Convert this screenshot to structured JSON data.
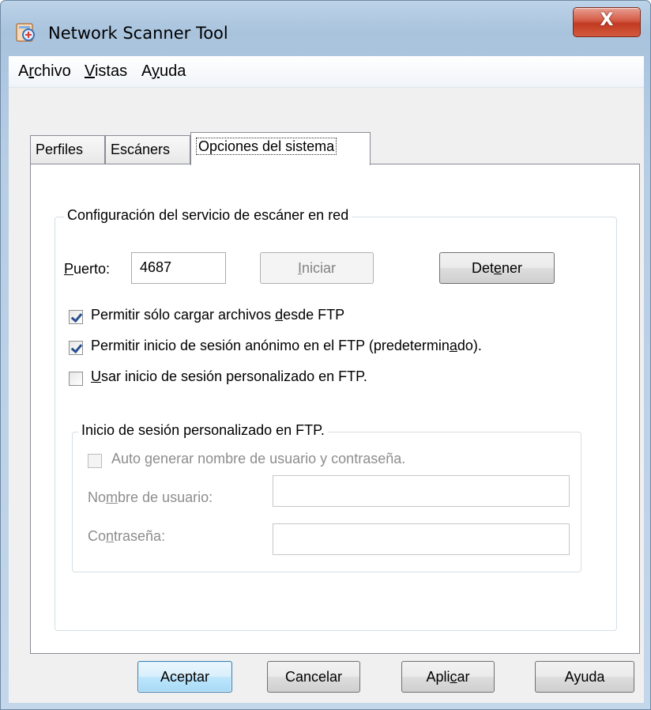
{
  "window": {
    "title": "Network Scanner Tool",
    "close_glyph": "X",
    "icon": "scanner-app-icon"
  },
  "menu": {
    "items": [
      {
        "label_pre": "A",
        "label_u": "r",
        "label_post": "chivo"
      },
      {
        "label_pre": "",
        "label_u": "V",
        "label_post": "istas"
      },
      {
        "label_pre": "A",
        "label_u": "y",
        "label_post": "uda"
      }
    ]
  },
  "tabs": [
    {
      "label": "Perfiles"
    },
    {
      "label": "Escáners"
    },
    {
      "label": "Opciones del sistema"
    }
  ],
  "service_group": {
    "title": "Configuración del servicio de escáner en red",
    "port_label_u": "P",
    "port_label_rest": "uerto:",
    "port_value": "4687",
    "start_button": {
      "pre": "",
      "u": "I",
      "post": "niciar"
    },
    "stop_button": {
      "pre": "Det",
      "u": "e",
      "post": "ner"
    },
    "options": [
      {
        "pre": "Permitir sólo cargar archivos ",
        "u": "d",
        "post": "esde FTP",
        "checked": true
      },
      {
        "pre": "Permitir inicio de sesión anónimo en el FTP (predetermin",
        "u": "a",
        "post": "do).",
        "checked": true
      },
      {
        "pre": "",
        "u": "U",
        "post": "sar inicio de sesión personalizado en FTP.",
        "checked": false
      }
    ]
  },
  "custom_login_group": {
    "title": "Inicio de sesión personalizado en FTP.",
    "auto_generate": {
      "pre": "Auto ",
      "u": "g",
      "post": "enerar nombre de usuario y contraseña.",
      "checked": false
    },
    "username_label": {
      "pre": "No",
      "u": "m",
      "post": "bre de usuario:"
    },
    "username_value": "",
    "password_label": {
      "pre": "Co",
      "u": "n",
      "post": "traseña:"
    },
    "password_value": ""
  },
  "footer_buttons": {
    "ok": {
      "pre": "Aceptar",
      "u": "",
      "post": ""
    },
    "cancel": {
      "pre": "Cancelar",
      "u": "",
      "post": ""
    },
    "apply": {
      "pre": "Apli",
      "u": "c",
      "post": "ar"
    },
    "help": {
      "pre": "Ayuda",
      "u": "",
      "post": ""
    }
  },
  "colors": {
    "title_bar": "#a9c3dd",
    "close_button": "#c23a22",
    "default_button": "#bee6fd",
    "disabled_text": "#8d8d8d"
  }
}
